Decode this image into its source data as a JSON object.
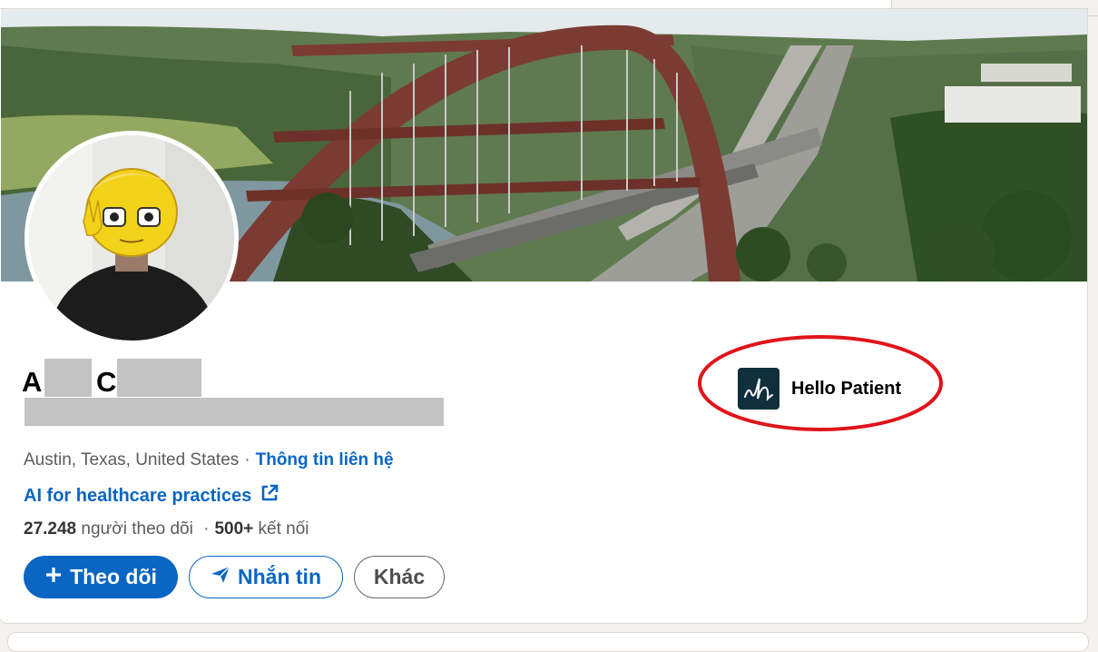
{
  "profile": {
    "name_initial_1": "A",
    "name_initial_2": "C",
    "location": "Austin, Texas, United States",
    "separator": "·",
    "contact_info_label": "Thông tin liên hệ",
    "website_label": "AI for healthcare practices",
    "followers_count": "27.248",
    "followers_label": "người theo dõi",
    "connections_count": "500+",
    "connections_label": "kết nối"
  },
  "actions": {
    "follow_label": "Theo dõi",
    "message_label": "Nhắn tin",
    "more_label": "Khác"
  },
  "company": {
    "name": "Hello Patient",
    "logo_glyph": "h"
  },
  "colors": {
    "accent": "#0a66c2",
    "annotation": "#e0141b",
    "logo_bg": "#0f2f3c"
  },
  "icons": {
    "follow": "plus-icon",
    "message": "paper-plane-icon",
    "external": "external-link-icon"
  }
}
